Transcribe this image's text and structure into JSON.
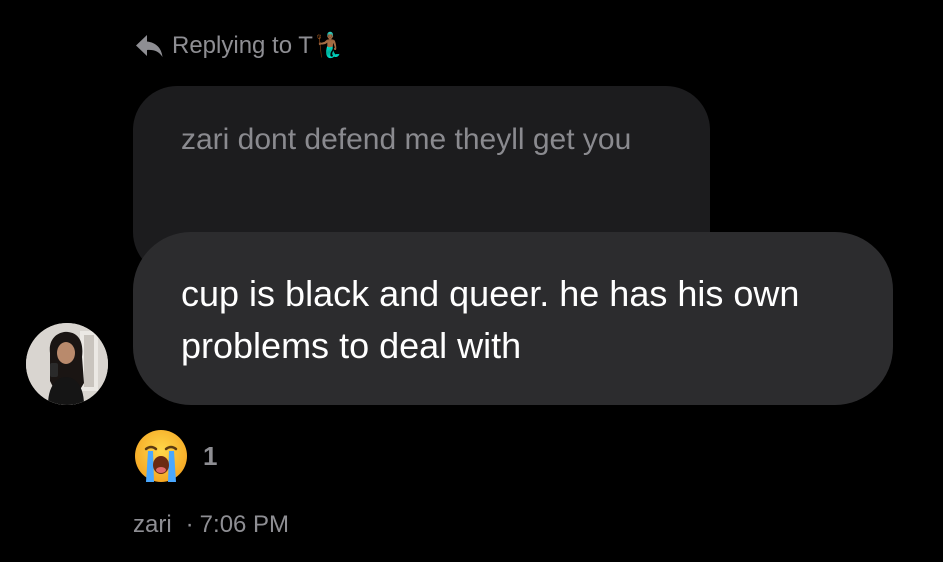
{
  "reply_header": {
    "label": "Replying to T",
    "emoji": "🧜🏾‍♂️",
    "icon": "reply-arrow-icon"
  },
  "quoted_message": {
    "text": "zari dont defend me theyll get you"
  },
  "message": {
    "text": "cup is black and queer. he has his own problems to deal with"
  },
  "reaction": {
    "emoji": "loudly-crying-face",
    "count": "1"
  },
  "footer": {
    "sender": "zari",
    "separator": "·",
    "time": "7:06 PM"
  },
  "colors": {
    "background": "#000000",
    "quoted_bubble": "#1c1c1e",
    "main_bubble": "#2c2c2e",
    "muted_text": "#8e8e93"
  }
}
